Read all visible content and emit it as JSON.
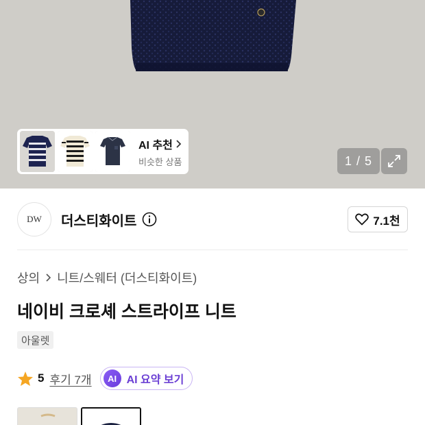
{
  "hero": {
    "recommendation": {
      "title": "AI 추천",
      "subtitle": "비슷한 상품",
      "thumbnails": [
        "navy-white-stripe-knit",
        "black-cream-stripe-knit",
        "navy-pocket-knit"
      ]
    },
    "pager": "1 / 5",
    "expand_icon": "expand-icon"
  },
  "brand": {
    "logo_text": "DW",
    "name": "더스티화이트",
    "info_icon": "info-icon",
    "like_count": "7.1천"
  },
  "breadcrumb": {
    "items": [
      "상의",
      "니트/스웨터 (더스티화이트)"
    ]
  },
  "product": {
    "title": "네이비 크로셰 스트라이프 니트",
    "tag": "아울렛"
  },
  "rating": {
    "value": "5",
    "reviews": "후기 7개",
    "ai_badge": "AI",
    "ai_summary": "AI 요약 보기"
  },
  "colors": {
    "accent": "#7b4ff0",
    "star": "#f5a623",
    "navy": "#1b2140"
  }
}
